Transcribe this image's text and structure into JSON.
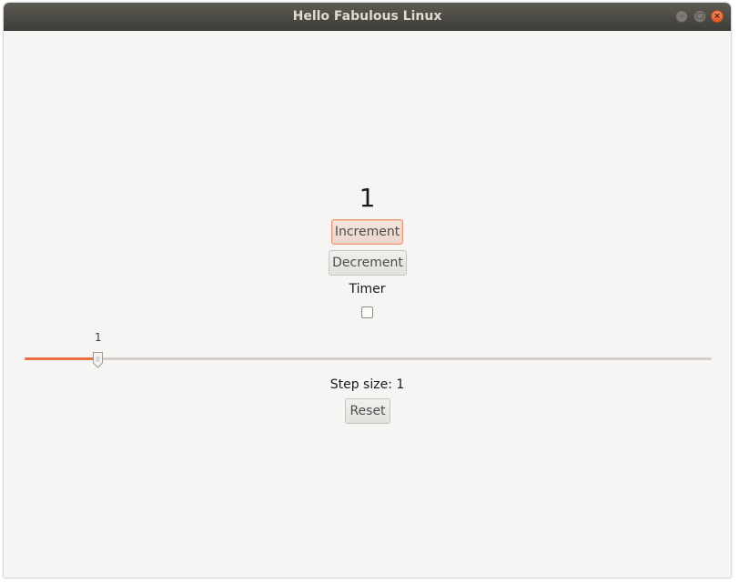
{
  "window": {
    "title": "Hello Fabulous Linux",
    "controls": {
      "minimize_icon": "minimize-icon",
      "maximize_icon": "maximize-icon",
      "close_icon": "close-icon"
    }
  },
  "counter": {
    "value": "1"
  },
  "buttons": {
    "increment": "Increment",
    "decrement": "Decrement",
    "reset": "Reset"
  },
  "timer": {
    "label": "Timer",
    "checked": false
  },
  "slider": {
    "value_label": "1",
    "min": 0,
    "max": 10,
    "value": 1
  },
  "step": {
    "label": "Step size: 1"
  },
  "colors": {
    "accent": "#ec6d3f",
    "window_bg": "#f6f5f4",
    "titlebar": "#3e3c37"
  }
}
